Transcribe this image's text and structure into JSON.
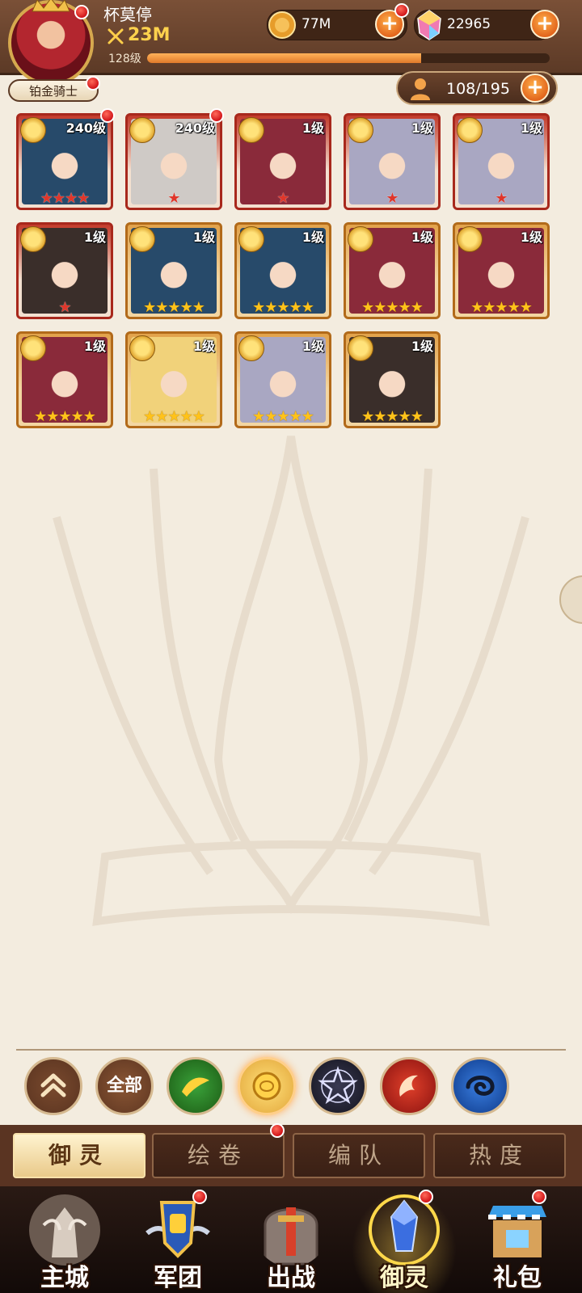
{
  "player": {
    "name": "杯莫停",
    "power": "23M",
    "level_label": "128级",
    "xp_progress": 0.68,
    "rank": "铂金骑士"
  },
  "currencies": {
    "gold": {
      "value": "77M",
      "icon": "gold-coin-icon"
    },
    "gems": {
      "value": "22965",
      "icon": "crystal-gem-icon"
    }
  },
  "capacity": {
    "value": "108/195",
    "icon": "person-icon"
  },
  "heroes": [
    {
      "level": "240级",
      "stars": "★★★★",
      "star_color": "red",
      "frame": "red",
      "alert": true
    },
    {
      "level": "240级",
      "stars": "★",
      "star_color": "red",
      "frame": "red",
      "alert": true
    },
    {
      "level": "1级",
      "stars": "★",
      "star_color": "red",
      "frame": "red",
      "alert": false
    },
    {
      "level": "1级",
      "stars": "★",
      "star_color": "red",
      "frame": "red",
      "alert": false
    },
    {
      "level": "1级",
      "stars": "★",
      "star_color": "red",
      "frame": "red",
      "alert": false
    },
    {
      "level": "1级",
      "stars": "★",
      "star_color": "red",
      "frame": "red",
      "alert": false
    },
    {
      "level": "1级",
      "stars": "★★★★★",
      "star_color": "gold",
      "frame": "gold",
      "alert": false
    },
    {
      "level": "1级",
      "stars": "★★★★★",
      "star_color": "gold",
      "frame": "gold",
      "alert": false
    },
    {
      "level": "1级",
      "stars": "★★★★★",
      "star_color": "gold",
      "frame": "gold",
      "alert": false
    },
    {
      "level": "1级",
      "stars": "★★★★★",
      "star_color": "gold",
      "frame": "gold",
      "alert": false
    },
    {
      "level": "1级",
      "stars": "★★★★★",
      "star_color": "gold",
      "frame": "gold",
      "alert": false
    },
    {
      "level": "1级",
      "stars": "★★★★★",
      "star_color": "gold",
      "frame": "gold",
      "alert": false
    },
    {
      "level": "1级",
      "stars": "★★★★★",
      "star_color": "gold",
      "frame": "gold",
      "alert": false
    },
    {
      "level": "1级",
      "stars": "★★★★★",
      "star_color": "gold",
      "frame": "gold",
      "alert": false
    }
  ],
  "filters": {
    "all_label": "全部",
    "items": [
      {
        "name": "collapse-up-icon"
      },
      {
        "name": "all"
      },
      {
        "name": "nature-element-icon"
      },
      {
        "name": "rose-element-icon",
        "selected": true
      },
      {
        "name": "dark-star-element-icon"
      },
      {
        "name": "phoenix-fire-element-icon"
      },
      {
        "name": "water-swirl-element-icon"
      }
    ]
  },
  "subtabs": [
    {
      "label": "御灵",
      "active": true
    },
    {
      "label": "绘卷",
      "alert": true
    },
    {
      "label": "编队"
    },
    {
      "label": "热度"
    }
  ],
  "nav": [
    {
      "label": "主城",
      "icon": "castle-statue-icon"
    },
    {
      "label": "军团",
      "icon": "legion-fist-shield-icon",
      "alert": true
    },
    {
      "label": "出战",
      "icon": "battle-sword-gate-icon"
    },
    {
      "label": "御灵",
      "icon": "spirit-crystal-icon",
      "active": true,
      "alert": true
    },
    {
      "label": "礼包",
      "icon": "gift-shop-icon",
      "alert": true
    }
  ],
  "colors": {
    "background": "#f3ecdf",
    "header": "#6a4430",
    "accent_orange": "#e2661d",
    "alert_red": "#d2161a",
    "gold_text": "#ffd24d"
  }
}
